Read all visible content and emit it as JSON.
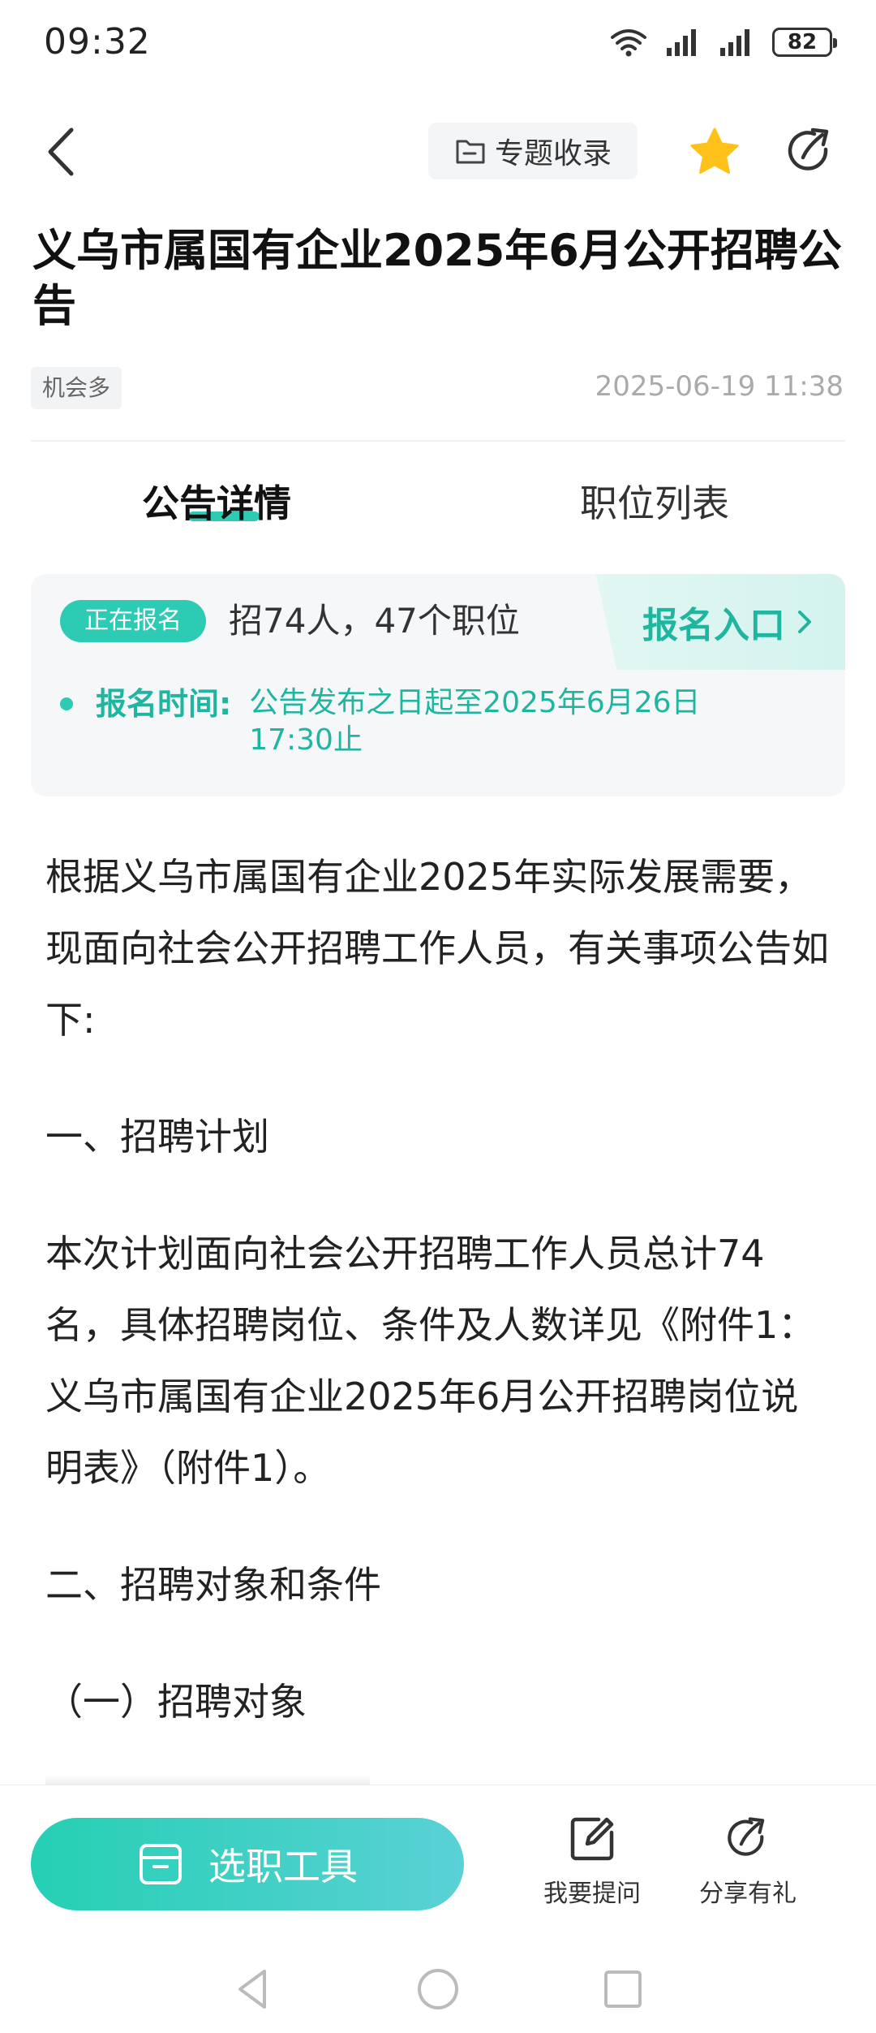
{
  "status_bar": {
    "time": "09:32",
    "battery": "82"
  },
  "nav": {
    "topic_label": "专题收录"
  },
  "article": {
    "title": "义乌市属国有企业2025年6月公开招聘公告",
    "tag": "机会多",
    "published": "2025-06-19 11:38"
  },
  "tabs": [
    {
      "label": "公告详情",
      "active": true
    },
    {
      "label": "职位列表",
      "active": false
    }
  ],
  "signup": {
    "status": "正在报名",
    "summary": "招74人，47个职位",
    "entry_label": "报名入口",
    "time_label": "报名时间:",
    "time_value": "公告发布之日起至2025年6月26日17:30止"
  },
  "content": {
    "p1": "根据义乌市属国有企业2025年实际发展需要，现面向社会公开招聘工作人员，有关事项公告如下:",
    "p2": "一、招聘计划",
    "p3": "本次计划面向社会公开招聘工作人员总计74名，具体招聘岗位、条件及人数详见《附件1：义乌市属国有企业2025年6月公开招聘岗位说明表》（附件1）。",
    "p4": "二、招聘对象和条件",
    "p5": "（一）招聘对象"
  },
  "bottom": {
    "tool_label": "选职工具",
    "ask_label": "我要提问",
    "share_label": "分享有礼"
  },
  "colors": {
    "accent": "#2ecbb4",
    "accent_text": "#1fb59e",
    "star": "#ffc21a"
  }
}
